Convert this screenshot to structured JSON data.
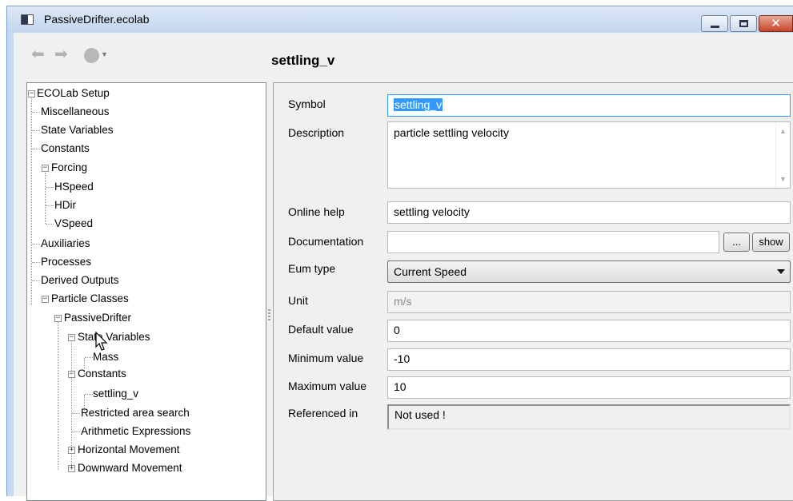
{
  "window": {
    "title": "PassiveDrifter.ecolab",
    "close_glyph": "✕"
  },
  "toolbar": {
    "back_icon": "arrow-left-icon",
    "forward_icon": "arrow-right-icon",
    "back_glyph": "⬅",
    "forward_glyph": "➡",
    "caret_glyph": "▼"
  },
  "page": {
    "title": "settling_v"
  },
  "tree": {
    "expander_minus": "−",
    "expander_plus": "+",
    "items": [
      {
        "label": "ECOLab Setup"
      },
      {
        "label": "Miscellaneous"
      },
      {
        "label": "State Variables"
      },
      {
        "label": "Constants"
      },
      {
        "label": "Forcing"
      },
      {
        "label": "HSpeed"
      },
      {
        "label": "HDir"
      },
      {
        "label": "VSpeed"
      },
      {
        "label": "Auxiliaries"
      },
      {
        "label": "Processes"
      },
      {
        "label": "Derived Outputs"
      },
      {
        "label": "Particle Classes"
      },
      {
        "label": "PassiveDrifter"
      },
      {
        "label": "State Variables"
      },
      {
        "label": "Mass"
      },
      {
        "label": "Constants"
      },
      {
        "label": "settling_v"
      },
      {
        "label": "Restricted area search"
      },
      {
        "label": "Arithmetic Expressions"
      },
      {
        "label": "Horizontal Movement"
      },
      {
        "label": "Downward Movement"
      }
    ]
  },
  "form": {
    "symbol_label": "Symbol",
    "symbol_value": "settling_v",
    "description_label": "Description",
    "description_value": "particle settling velocity",
    "online_help_label": "Online help",
    "online_help_value": "settling velocity",
    "documentation_label": "Documentation",
    "documentation_value": "",
    "browse_button": "...",
    "show_button": "show",
    "eum_type_label": "Eum type",
    "eum_type_value": "Current Speed",
    "unit_label": "Unit",
    "unit_value": "m/s",
    "default_label": "Default value",
    "default_value": "0",
    "min_label": "Minimum value",
    "min_value": "-10",
    "max_label": "Maximum value",
    "max_value": "10",
    "referenced_label": "Referenced in",
    "referenced_value": "Not used !"
  },
  "colors": {
    "selection": "#3399ff",
    "title_bar": "#c9daf0",
    "close_button": "#c9462b"
  }
}
